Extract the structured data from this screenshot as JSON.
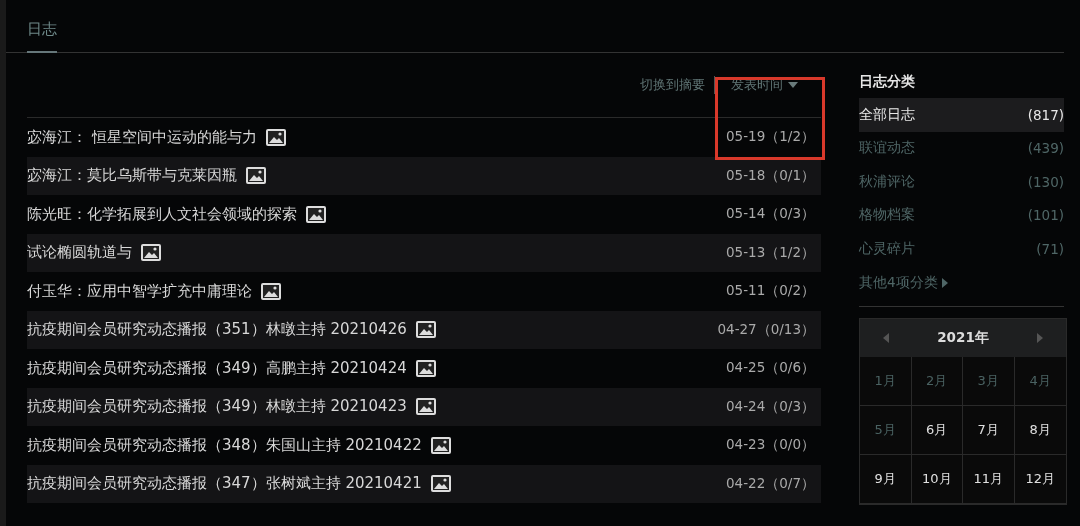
{
  "tab": {
    "label": "日志",
    "selected": true
  },
  "toolbar": {
    "switch_link": "切换到摘要",
    "sort_label": "发表时间"
  },
  "posts": [
    {
      "title": "宓海江： 恒星空间中运动的能与力",
      "has_image": true,
      "meta": "05-19（1/2）",
      "highlighted": true
    },
    {
      "title": "宓海江：莫比乌斯带与克莱因瓶",
      "has_image": true,
      "meta": "05-18（0/1）",
      "highlighted": false
    },
    {
      "title": "陈光旺：化学拓展到人文社会领域的探索",
      "has_image": true,
      "meta": "05-14（0/3）",
      "highlighted": false
    },
    {
      "title": "试论椭圆轨道与",
      "has_image": true,
      "meta": "05-13（1/2）",
      "highlighted": false
    },
    {
      "title": "付玉华：应用中智学扩充中庸理论",
      "has_image": true,
      "meta": "05-11（0/2）",
      "highlighted": false
    },
    {
      "title": "抗疫期间会员研究动态播报（351）林暾主持 20210426",
      "has_image": true,
      "meta": "04-27（0/13）",
      "highlighted": false
    },
    {
      "title": "抗疫期间会员研究动态播报（349）高鹏主持 20210424",
      "has_image": true,
      "meta": "04-25（0/6）",
      "highlighted": false
    },
    {
      "title": "抗疫期间会员研究动态播报（349）林暾主持 20210423",
      "has_image": true,
      "meta": "04-24（0/3）",
      "highlighted": false
    },
    {
      "title": "抗疫期间会员研究动态播报（348）朱国山主持 20210422",
      "has_image": true,
      "meta": "04-23（0/0）",
      "highlighted": false
    },
    {
      "title": "抗疫期间会员研究动态播报（347）张树斌主持 20210421",
      "has_image": true,
      "meta": "04-22（0/7）",
      "highlighted": false
    }
  ],
  "sidebar": {
    "title": "日志分类",
    "categories": [
      {
        "name": "全部日志",
        "count": "(817)",
        "selected": true
      },
      {
        "name": "联谊动态",
        "count": "(439)",
        "selected": false
      },
      {
        "name": "秋浦评论",
        "count": "(130)",
        "selected": false
      },
      {
        "name": "格物档案",
        "count": "(101)",
        "selected": false
      },
      {
        "name": "心灵碎片",
        "count": "(71)",
        "selected": false
      }
    ],
    "more": "其他4项分类",
    "calendar": {
      "year": "2021年",
      "months": [
        {
          "label": "1月",
          "linked": true
        },
        {
          "label": "2月",
          "linked": true
        },
        {
          "label": "3月",
          "linked": true
        },
        {
          "label": "4月",
          "linked": true
        },
        {
          "label": "5月",
          "linked": true
        },
        {
          "label": "6月",
          "linked": false
        },
        {
          "label": "7月",
          "linked": false
        },
        {
          "label": "8月",
          "linked": false
        },
        {
          "label": "9月",
          "linked": false
        },
        {
          "label": "10月",
          "linked": false
        },
        {
          "label": "11月",
          "linked": false
        },
        {
          "label": "12月",
          "linked": false
        }
      ]
    }
  }
}
